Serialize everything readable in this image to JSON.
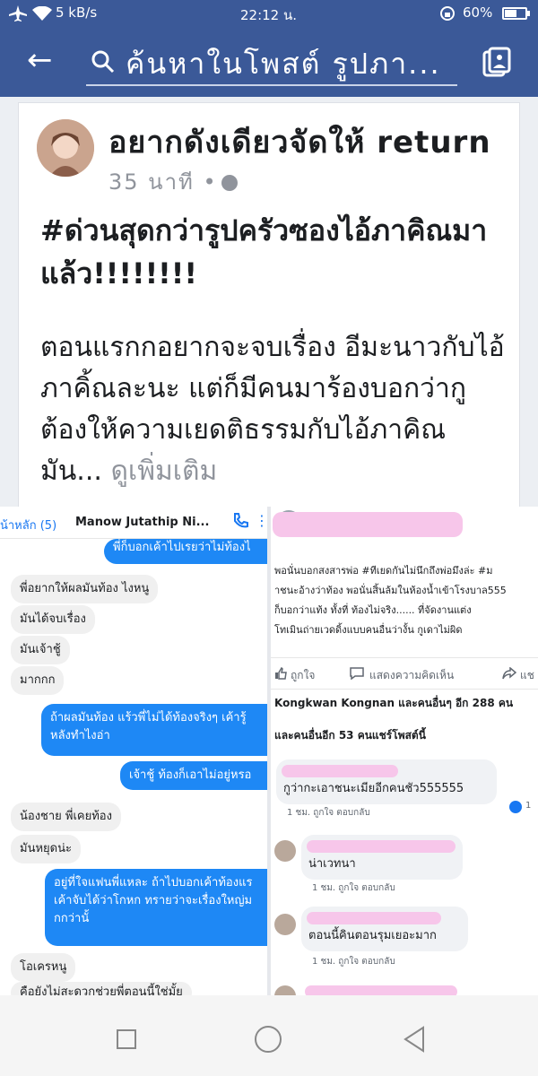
{
  "status_bar": {
    "speed": "5 kB/s",
    "time": "22:12 น.",
    "battery": "60%",
    "battery_level": 0.6
  },
  "header": {
    "search_text": "ค้นหาในโพสต์ รูปภา..."
  },
  "post": {
    "author": "อยากดังเดียวจัดให้ return",
    "time": "35 นาที •",
    "headline": "#ด่วนสุดกว่ารูปครัวซองไอ้ภาคิณมาแล้ว!!!!!!!!",
    "body": "ตอนแรกกอยากจะจบเรื่อง อีมะนาวกับไอ้ภาคิ้ณละนะ แต่ก็มีคนมาร้องบอกว่ากูต้องให้ความเยดติธรรมกับไอ้ภาคิณมัน...",
    "see_more": "ดูเพิ่มเติม"
  },
  "chat": {
    "back_label": "น้าหลัก (5)",
    "contact_name": "Manow Jutathip Ni...",
    "messages": [
      {
        "dir": "out",
        "text": "พี่ก็บอกเค้าไปเรยว่าไม่ท้องไ"
      },
      {
        "dir": "in",
        "text": "พี่อยากให้ผลมันท้อง ไงหนู"
      },
      {
        "dir": "in",
        "text": "มันได้จบเรื่อง"
      },
      {
        "dir": "in",
        "text": "มันเจ้าชู้"
      },
      {
        "dir": "in",
        "text": "มากกก"
      },
      {
        "dir": "out",
        "text": "ถ้าผลมันท้อง แร้วพี่ไม่ได้ท้องจริงๆ เค้ารู้"
      },
      {
        "dir": "out",
        "text": "หลังทำไงอ่า"
      },
      {
        "dir": "out",
        "text": "เจ้าชู้ ท้องก็เอาไม่อยู่หรอ"
      },
      {
        "dir": "in",
        "text": "น้องชาย พี่เคยท้อง"
      },
      {
        "dir": "in",
        "text": "มันหยุดน่ะ"
      },
      {
        "dir": "out",
        "text": "อยู่ที่ใจแฟนพี่แหละ ถ้าไปบอกเค้าท้องแร"
      },
      {
        "dir": "out",
        "text": "เค้าจับได้ว่าโกหก ทรายว่าจะเรื่องใหญ่ม"
      },
      {
        "dir": "out",
        "text": "กกว่านั้"
      },
      {
        "dir": "in",
        "text": "โอเครหนู"
      },
      {
        "dir": "in",
        "text": "คือยังไม่สะดวกช่วยพี่ตอนนี้ใช่มั้ย"
      }
    ]
  },
  "fb_post": {
    "lines": [
      "พอนั่นบอกสงสารพ่อ #ทีเยดกันไม่นึกถึงพ่อมึงล่ะ #ม",
      "าชนะอ้างว่าท้อง พอนั่นสิ้นล้มในห้องน้ำเข้าโรงบาล555",
      "ก็บอกว่าแท้ง ทั้งที่ ท้องไม่จริง...... ที่จัดงานแต่ง",
      "โทเมินถ่ายเวดดิ้งแบบคนอื่นว่างั้น กูเดาไม่ผิด"
    ],
    "like_label": "ถูกใจ",
    "comment_label": "แสดงความคิดเห็น",
    "share_label": "แช",
    "likes_text": "Kongkwan Kongnan และคนอื่นๆ อีก 288 คน",
    "shares_text": "และคนอื่นอีก 53 คนแชร์โพสต์นี้",
    "comments": [
      {
        "text": "กูว่ากะเอาชนะเมียอีกคนชัว555555",
        "meta": "1 ชม.   ถูกใจ   ตอบกลับ",
        "reactions": "1"
      },
      {
        "text": "น่าเวทนา",
        "meta": "1 ชม.   ถูกใจ   ตอบกลับ"
      },
      {
        "text": "ตอนนี้คินตอนรุมเยอะมาก",
        "meta": "1 ชม.   ถูกใจ   ตอบกลับ"
      }
    ]
  },
  "colors": {
    "facebook_blue": "#3b5998",
    "messenger_blue": "#1e88f5",
    "redaction_pink": "#f7c6ea"
  },
  "icons": [
    "airplane-icon",
    "wifi-icon",
    "back-arrow-icon",
    "search-icon",
    "photo-icon",
    "globe-icon",
    "phone-icon",
    "like-icon",
    "comment-icon",
    "share-icon",
    "recent-apps-icon",
    "home-icon",
    "back-nav-icon"
  ]
}
